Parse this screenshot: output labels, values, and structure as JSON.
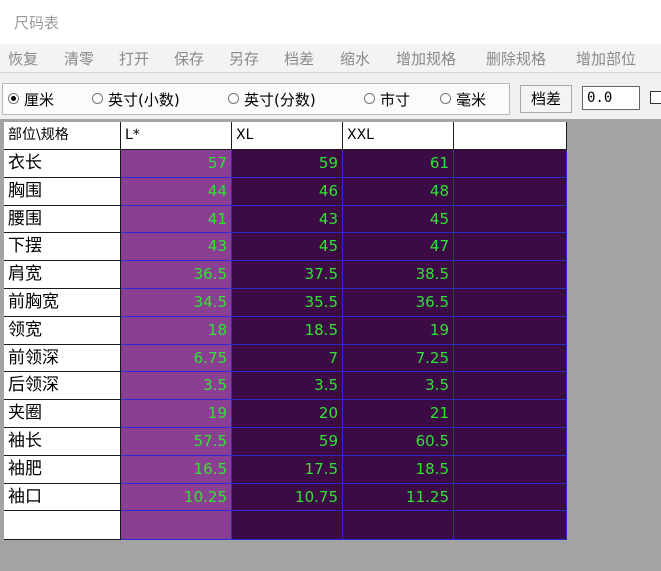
{
  "window": {
    "title": "尺码表"
  },
  "menu": [
    "恢复",
    "清零",
    "打开",
    "保存",
    "另存",
    "档差",
    "缩水",
    "增加规格",
    "删除规格",
    "增加部位"
  ],
  "units": {
    "options": [
      "厘米",
      "英寸(小数)",
      "英寸(分数)",
      "市寸",
      "毫米"
    ],
    "selected": "厘米"
  },
  "grade": {
    "button_label": "档差",
    "value": "0.0"
  },
  "table": {
    "corner": "部位\\规格",
    "sizes": [
      "L*",
      "XL",
      "XXL",
      ""
    ],
    "rows": [
      {
        "part": "衣长",
        "values": [
          "57",
          "59",
          "61",
          ""
        ]
      },
      {
        "part": "胸围",
        "values": [
          "44",
          "46",
          "48",
          ""
        ]
      },
      {
        "part": "腰围",
        "values": [
          "41",
          "43",
          "45",
          ""
        ]
      },
      {
        "part": "下摆",
        "values": [
          "43",
          "45",
          "47",
          ""
        ]
      },
      {
        "part": "肩宽",
        "values": [
          "36.5",
          "37.5",
          "38.5",
          ""
        ]
      },
      {
        "part": "前胸宽",
        "values": [
          "34.5",
          "35.5",
          "36.5",
          ""
        ]
      },
      {
        "part": "领宽",
        "values": [
          "18",
          "18.5",
          "19",
          ""
        ]
      },
      {
        "part": "前领深",
        "values": [
          "6.75",
          "7",
          "7.25",
          ""
        ]
      },
      {
        "part": "后领深",
        "values": [
          "3.5",
          "3.5",
          "3.5",
          ""
        ]
      },
      {
        "part": "夹圈",
        "values": [
          "19",
          "20",
          "21",
          ""
        ]
      },
      {
        "part": "袖长",
        "values": [
          "57.5",
          "59",
          "60.5",
          ""
        ]
      },
      {
        "part": "袖肥",
        "values": [
          "16.5",
          "17.5",
          "18.5",
          ""
        ]
      },
      {
        "part": "袖口",
        "values": [
          "10.25",
          "10.75",
          "11.25",
          ""
        ]
      },
      {
        "part": "",
        "values": [
          "",
          "",
          "",
          ""
        ]
      }
    ]
  },
  "colors": {
    "value_text": "#31e431",
    "selected_column": "#8a3f92",
    "cell_background": "#3c0a45",
    "grid_line": "#2b2bd6"
  }
}
